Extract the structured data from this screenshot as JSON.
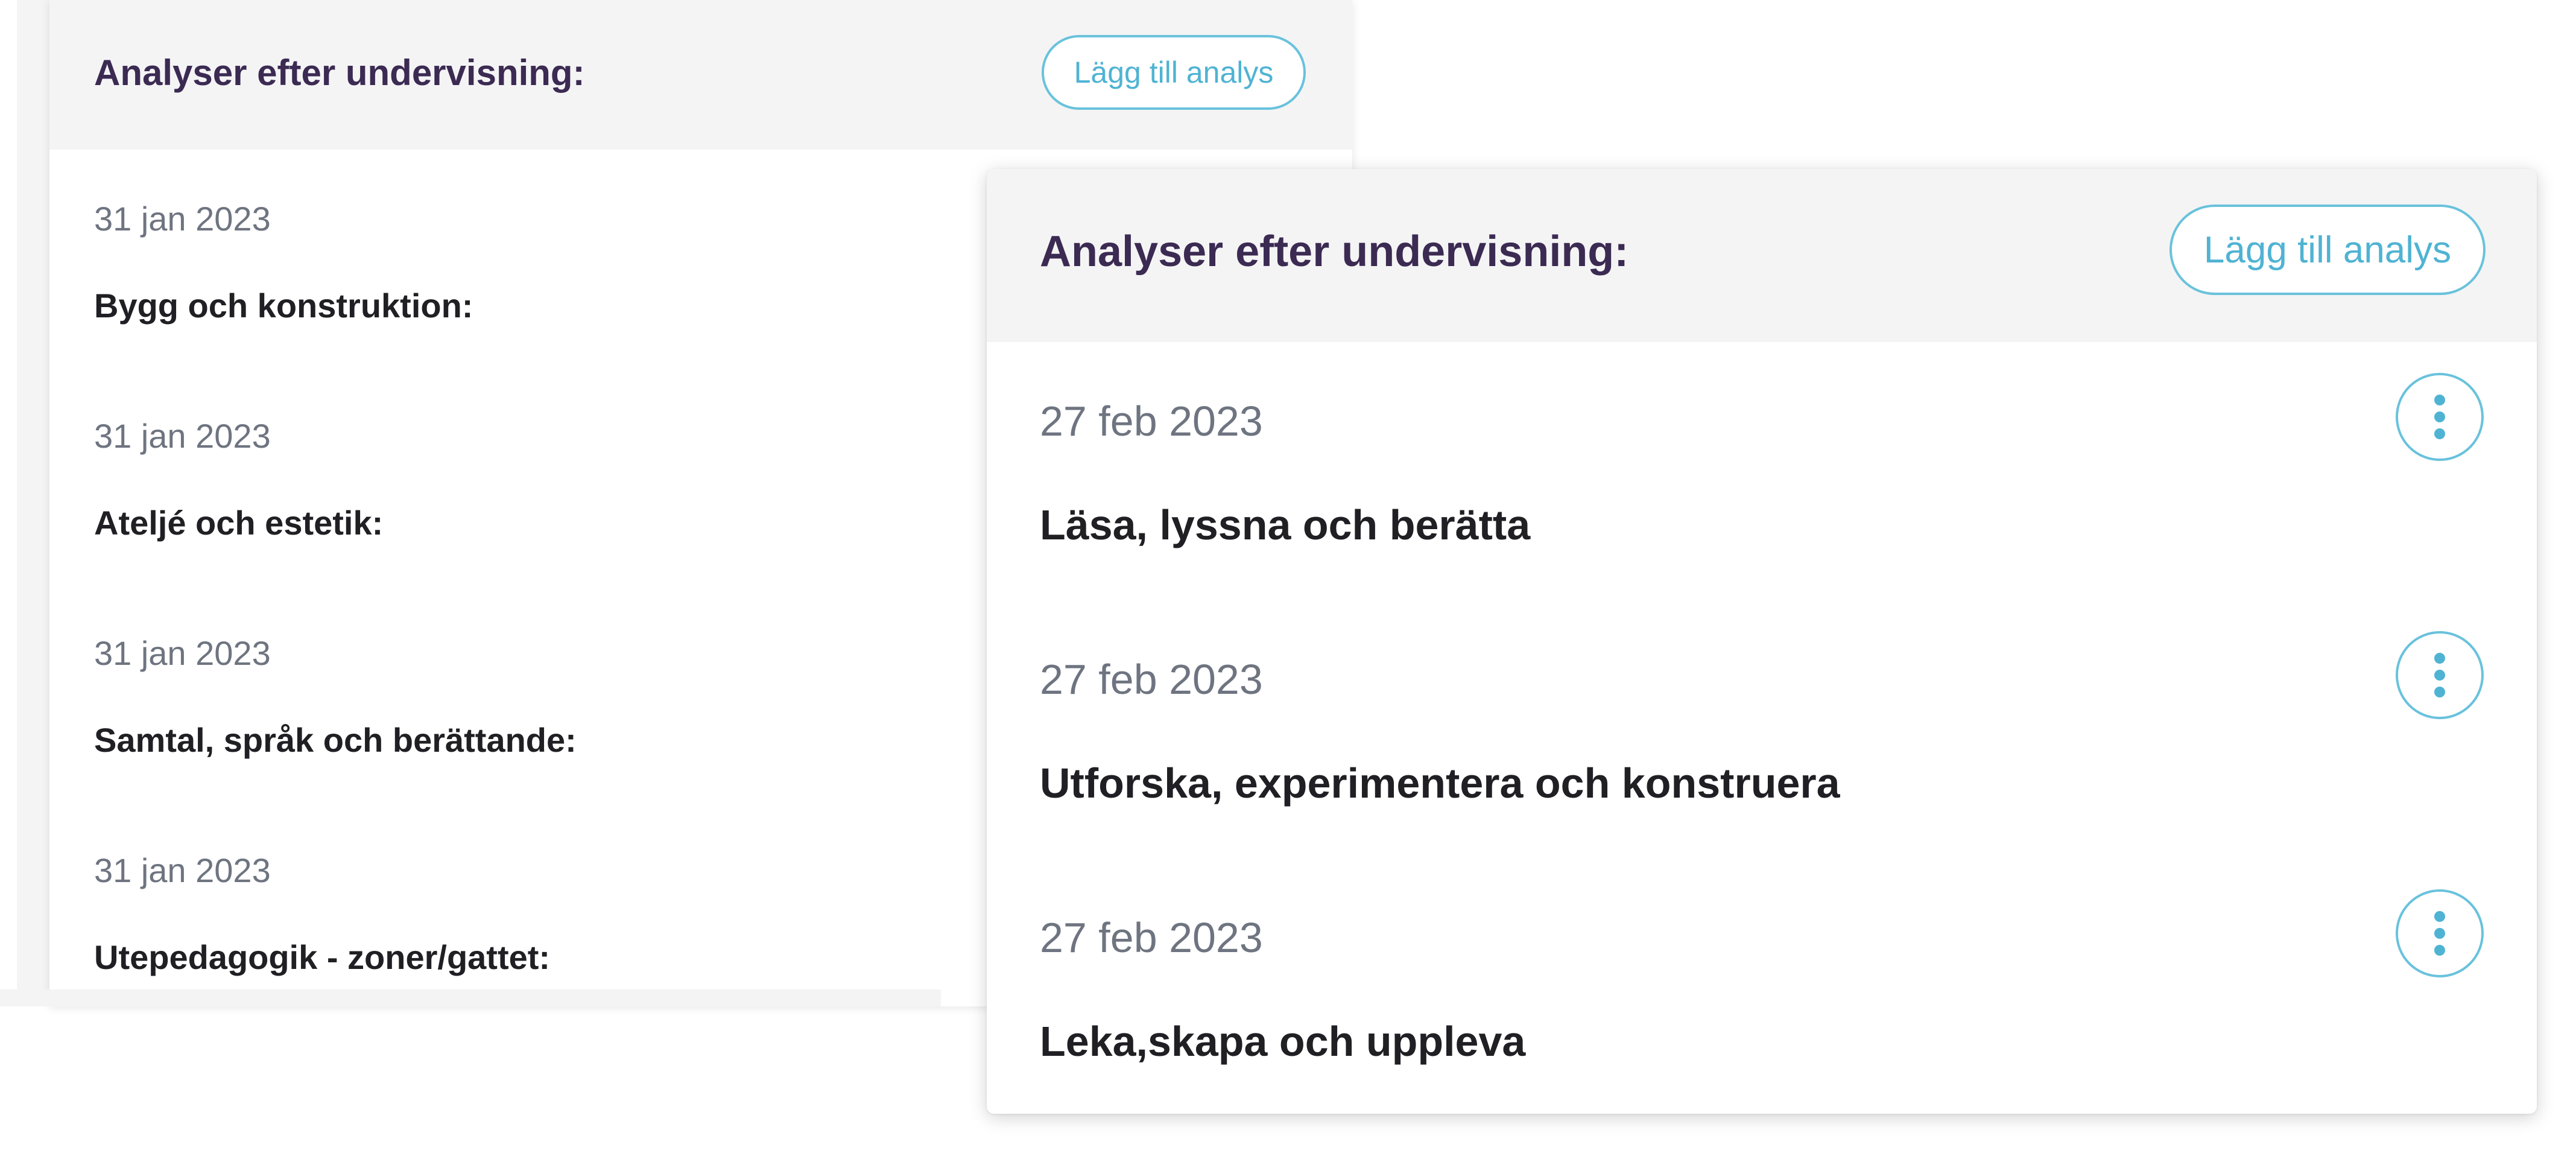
{
  "back_panel": {
    "header_title": "Analyser efter undervisning:",
    "add_button_label": "Lägg till analys",
    "entries": [
      {
        "date": "31 jan 2023",
        "title": "Bygg och konstruktion:"
      },
      {
        "date": "31 jan 2023",
        "title": "Ateljé och estetik:"
      },
      {
        "date": "31 jan 2023",
        "title": "Samtal, språk och berättande:"
      },
      {
        "date": "31 jan 2023",
        "title": "Utepedagogik - zoner/gattet:"
      }
    ]
  },
  "front_panel": {
    "header_title": "Analyser efter undervisning:",
    "add_button_label": "Lägg till analys",
    "entries": [
      {
        "date": "27 feb 2023",
        "title": "Läsa, lyssna och berätta",
        "menu_icon": "vertical-ellipsis-icon"
      },
      {
        "date": "27 feb 2023",
        "title": "Utforska, experimentera och konstruera",
        "menu_icon": "vertical-ellipsis-icon"
      },
      {
        "date": "27 feb 2023",
        "title": "Leka,skapa och uppleva",
        "menu_icon": "vertical-ellipsis-icon"
      }
    ]
  },
  "colors": {
    "accent": "#4fb3d3",
    "heading": "#3b2a52",
    "date_text": "#6e7480",
    "title_text": "#1f1f24",
    "header_bg": "#f4f4f5"
  }
}
